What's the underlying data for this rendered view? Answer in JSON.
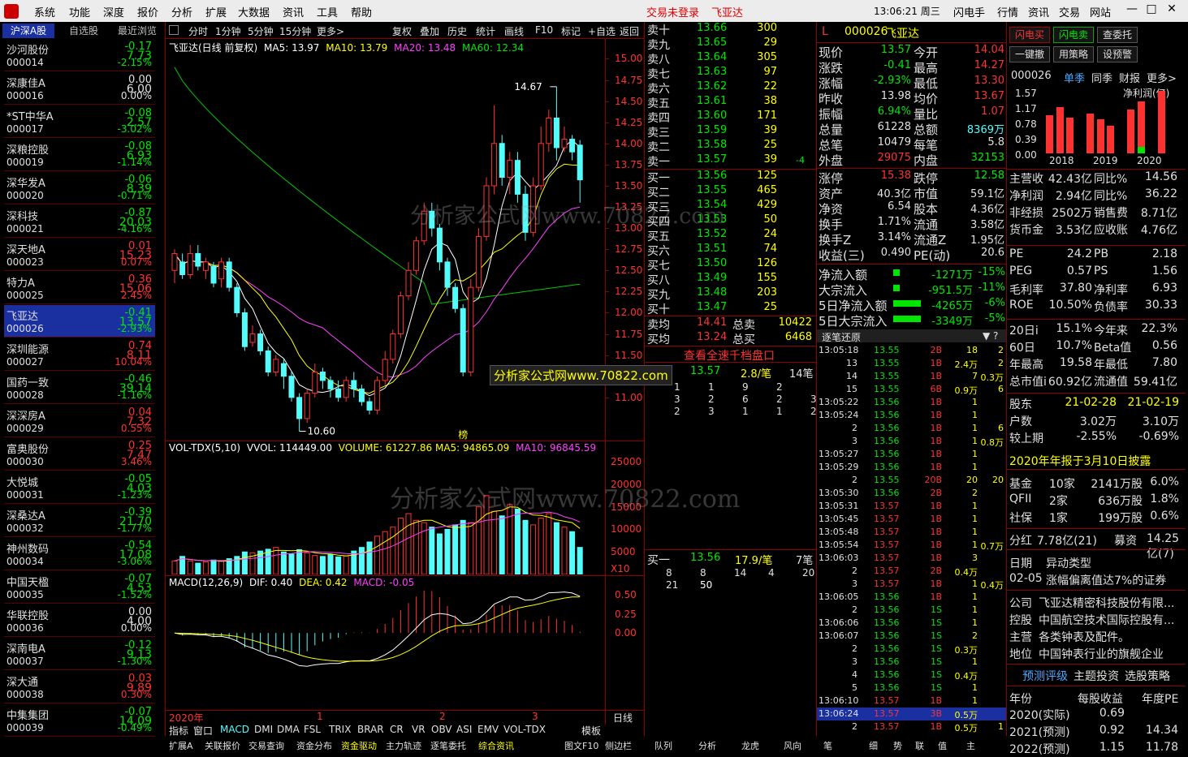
{
  "menu": {
    "items": [
      "系统",
      "功能",
      "深度",
      "报价",
      "分析",
      "扩展",
      "大数据",
      "资讯",
      "工具",
      "帮助"
    ],
    "trade_login": "交易未登录",
    "stock_name": "飞亚达",
    "clock": "13:06:21 周三",
    "right_items": [
      "闪电手",
      "行情",
      "资讯",
      "交易",
      "网站"
    ]
  },
  "list_tabs": [
    "沪深A股",
    "自选股",
    "最近浏览"
  ],
  "stocks": [
    {
      "name": "沙河股份",
      "code": "000014",
      "price": "7.73",
      "chg": "-0.17",
      "pct": "-2.15%",
      "up": false
    },
    {
      "name": "深康佳A",
      "code": "000016",
      "price": "6.00",
      "chg": "0.00",
      "pct": "0.00%",
      "up": null
    },
    {
      "name": "*ST中华A",
      "code": "000017",
      "price": "2.57",
      "chg": "-0.08",
      "pct": "-3.02%",
      "up": false
    },
    {
      "name": "深粮控股",
      "code": "000019",
      "price": "6.93",
      "chg": "-0.08",
      "pct": "-1.14%",
      "up": false
    },
    {
      "name": "深华发A",
      "code": "000020",
      "price": "8.39",
      "chg": "-0.06",
      "pct": "-0.71%",
      "up": false
    },
    {
      "name": "深科技",
      "code": "000021",
      "price": "20.03",
      "chg": "-0.87",
      "pct": "-4.16%",
      "up": false
    },
    {
      "name": "深天地A",
      "code": "000023",
      "price": "15.23",
      "chg": "0.01",
      "pct": "0.07%",
      "up": true
    },
    {
      "name": "特力A",
      "code": "000025",
      "price": "15.06",
      "chg": "0.36",
      "pct": "2.45%",
      "up": true
    },
    {
      "name": "飞亚达",
      "code": "000026",
      "price": "13.57",
      "chg": "-0.41",
      "pct": "-2.93%",
      "up": false,
      "selected": true
    },
    {
      "name": "深圳能源",
      "code": "000027",
      "price": "8.11",
      "chg": "0.74",
      "pct": "10.04%",
      "up": true
    },
    {
      "name": "国药一致",
      "code": "000028",
      "price": "39.14",
      "chg": "-0.46",
      "pct": "-1.16%",
      "up": false
    },
    {
      "name": "深深房A",
      "code": "000029",
      "price": "7.32",
      "chg": "0.04",
      "pct": "0.55%",
      "up": true
    },
    {
      "name": "富奥股份",
      "code": "000030",
      "price": "7.47",
      "chg": "0.25",
      "pct": "3.46%",
      "up": true
    },
    {
      "name": "大悦城",
      "code": "000031",
      "price": "4.03",
      "chg": "-0.05",
      "pct": "-1.23%",
      "up": false
    },
    {
      "name": "深桑达A",
      "code": "000032",
      "price": "21.70",
      "chg": "-0.39",
      "pct": "-1.77%",
      "up": false
    },
    {
      "name": "神州数码",
      "code": "000034",
      "price": "17.08",
      "chg": "-0.54",
      "pct": "-3.06%",
      "up": false
    },
    {
      "name": "中国天楹",
      "code": "000035",
      "price": "4.53",
      "chg": "-0.07",
      "pct": "-1.52%",
      "up": false
    },
    {
      "name": "华联控股",
      "code": "000036",
      "price": "4.00",
      "chg": "0.00",
      "pct": "0.00%",
      "up": null
    },
    {
      "name": "深南电A",
      "code": "000037",
      "price": "9.13",
      "chg": "-0.12",
      "pct": "-1.30%",
      "up": false
    },
    {
      "name": "深大通",
      "code": "000038",
      "price": "9.89",
      "chg": "0.03",
      "pct": "0.30%",
      "up": true
    },
    {
      "name": "中集集团",
      "code": "000039",
      "price": "14.09",
      "chg": "-0.07",
      "pct": "-0.49%",
      "up": false
    }
  ],
  "chart_toolbar": [
    "分时",
    "1分钟",
    "5分钟",
    "15分钟",
    "更多>",
    "复权",
    "叠加",
    "历史",
    "统计",
    "画线",
    "F10",
    "标记",
    "+自选",
    "返回"
  ],
  "kline_header": {
    "title": "飞亚达(日线 前复权)",
    "ma5": "MA5: 13.97",
    "ma10": "MA10: 13.79",
    "ma20": "MA20: 13.48",
    "ma60": "MA60: 12.34"
  },
  "kline_axis": [
    "15.00",
    "14.75",
    "14.50",
    "14.25",
    "14.00",
    "13.75",
    "13.50",
    "13.25",
    "13.00",
    "12.75",
    "12.50",
    "12.25",
    "12.00",
    "11.75",
    "11.50",
    "11.25",
    "11.00"
  ],
  "kline_marks": {
    "high": "14.67",
    "low": "10.60",
    "bang": "榜"
  },
  "kline_candles": [
    [
      12.5,
      12.7,
      12.35,
      12.75
    ],
    [
      12.6,
      12.45,
      12.4,
      12.7
    ],
    [
      12.45,
      12.7,
      12.4,
      12.8
    ],
    [
      12.7,
      12.55,
      12.5,
      12.8
    ],
    [
      12.5,
      12.6,
      12.4,
      12.65
    ],
    [
      12.55,
      12.35,
      12.3,
      12.6
    ],
    [
      12.4,
      12.6,
      12.3,
      12.65
    ],
    [
      12.6,
      12.3,
      12.25,
      12.65
    ],
    [
      12.3,
      12.0,
      11.95,
      12.35
    ],
    [
      12.0,
      11.6,
      11.55,
      12.05
    ],
    [
      11.65,
      11.75,
      11.6,
      11.85
    ],
    [
      11.75,
      11.55,
      11.5,
      11.8
    ],
    [
      11.55,
      11.3,
      11.25,
      11.6
    ],
    [
      11.3,
      11.45,
      11.25,
      11.5
    ],
    [
      11.4,
      11.25,
      11.1,
      11.45
    ],
    [
      11.25,
      11.0,
      10.95,
      11.3
    ],
    [
      11.0,
      10.75,
      10.6,
      11.05
    ],
    [
      10.75,
      11.05,
      10.7,
      11.1
    ],
    [
      11.05,
      11.3,
      11.0,
      11.4
    ],
    [
      11.3,
      11.2,
      11.1,
      11.35
    ],
    [
      11.2,
      11.1,
      11.0,
      11.25
    ],
    [
      11.1,
      11.0,
      10.95,
      11.2
    ],
    [
      11.0,
      11.2,
      10.95,
      11.25
    ],
    [
      11.2,
      11.1,
      11.0,
      11.3
    ],
    [
      11.1,
      10.95,
      10.9,
      11.15
    ],
    [
      10.95,
      10.85,
      10.8,
      11.0
    ],
    [
      10.85,
      11.2,
      10.8,
      11.25
    ],
    [
      11.2,
      11.45,
      11.15,
      11.55
    ],
    [
      11.45,
      11.75,
      11.4,
      11.8
    ],
    [
      11.75,
      12.2,
      11.7,
      12.25
    ],
    [
      12.2,
      12.5,
      12.15,
      12.6
    ],
    [
      12.5,
      12.85,
      12.45,
      12.9
    ],
    [
      12.85,
      13.2,
      12.8,
      13.3
    ],
    [
      13.2,
      13.0,
      12.9,
      13.3
    ],
    [
      13.0,
      12.6,
      12.5,
      13.05
    ],
    [
      12.6,
      12.3,
      12.2,
      12.65
    ],
    [
      12.3,
      12.05,
      12.0,
      12.35
    ],
    [
      12.05,
      11.3,
      11.25,
      12.1
    ],
    [
      11.3,
      12.3,
      11.25,
      12.4
    ],
    [
      12.3,
      12.9,
      12.25,
      13.0
    ],
    [
      12.9,
      13.5,
      12.85,
      13.6
    ],
    [
      13.5,
      14.0,
      13.4,
      14.45
    ],
    [
      14.0,
      13.6,
      13.5,
      14.1
    ],
    [
      13.6,
      13.8,
      13.4,
      13.9
    ],
    [
      13.8,
      13.4,
      13.3,
      13.9
    ],
    [
      13.4,
      12.95,
      12.85,
      13.5
    ],
    [
      12.95,
      13.5,
      12.9,
      13.6
    ],
    [
      13.5,
      14.0,
      13.45,
      14.2
    ],
    [
      14.0,
      14.3,
      13.9,
      14.4
    ],
    [
      14.3,
      13.95,
      13.8,
      14.67
    ],
    [
      13.95,
      14.05,
      13.9,
      14.2
    ],
    [
      14.05,
      13.9,
      13.8,
      14.1
    ],
    [
      13.98,
      13.57,
      13.3,
      14.04
    ]
  ],
  "vol_header": {
    "name": "VOL-TDX(5,10)",
    "vvol": "VVOL: 114449.00",
    "volume": "VOLUME: 61227.86",
    "ma5": "MA5: 94865.09",
    "ma10": "MA10: 96845.59"
  },
  "vol_axis": [
    "25000",
    "20000",
    "15000",
    "10000",
    "5000",
    "X10"
  ],
  "volumes": [
    3000,
    4000,
    3000,
    2500,
    2800,
    3200,
    3000,
    3500,
    4000,
    5000,
    4800,
    5200,
    5600,
    6000,
    5000,
    4500,
    5500,
    4800,
    4200,
    4000,
    4400,
    3900,
    4100,
    5200,
    6000,
    7200,
    8500,
    9500,
    10500,
    12500,
    13500,
    12000,
    11500,
    10500,
    9000,
    10000,
    11000,
    12000,
    11500,
    15000,
    17500,
    14000,
    13000,
    15500,
    14500,
    12000,
    11000,
    12500,
    13500,
    11500,
    10500,
    9500,
    6000
  ],
  "macd_header": {
    "name": "MACD(12,26,9)",
    "dif": "DIF: 0.40",
    "dea": "DEA: 0.42",
    "macd": "MACD: -0.05"
  },
  "macd_axis": [
    "0.50",
    "0.25",
    "0.00"
  ],
  "date_axis": {
    "year": "2020年",
    "m1": "1",
    "m2": "2",
    "m3": "3",
    "period": "日线"
  },
  "indicator_tabs": [
    "指标",
    "窗口",
    "MACD",
    "DMI",
    "DMA",
    "FSL",
    "TRIX",
    "BRAR",
    "CR",
    "VR",
    "OBV",
    "ASI",
    "EMV",
    "VOL-TDX",
    "模板"
  ],
  "bottom_tabs": [
    "扩展A",
    "关联报价",
    "交易查询",
    "资金分布",
    "资金驱动",
    "主力轨迹",
    "逐笔委托",
    "综合资讯",
    "图文F10",
    "侧边栏"
  ],
  "watermark1": "分析家公式网www.70822.com",
  "watermark2": "分析家公式网www.70822.com",
  "watermark3": "分析家公式网www.70822.com",
  "orderbook": {
    "sell": [
      [
        "卖十",
        "13.66",
        "300"
      ],
      [
        "卖九",
        "13.65",
        "29"
      ],
      [
        "卖八",
        "13.64",
        "305"
      ],
      [
        "卖七",
        "13.63",
        "97"
      ],
      [
        "卖六",
        "13.62",
        "22"
      ],
      [
        "卖五",
        "13.61",
        "38"
      ],
      [
        "卖四",
        "13.60",
        "171"
      ],
      [
        "卖三",
        "13.59",
        "39"
      ],
      [
        "卖二",
        "13.58",
        "25"
      ],
      [
        "卖一",
        "13.57",
        "39",
        "-4"
      ]
    ],
    "buy": [
      [
        "买一",
        "13.56",
        "125"
      ],
      [
        "买二",
        "13.55",
        "465"
      ],
      [
        "买三",
        "13.54",
        "429"
      ],
      [
        "买四",
        "13.53",
        "50"
      ],
      [
        "买五",
        "13.52",
        "24"
      ],
      [
        "买六",
        "13.51",
        "74"
      ],
      [
        "买七",
        "13.50",
        "126"
      ],
      [
        "买八",
        "13.49",
        "155"
      ],
      [
        "买九",
        "13.48",
        "203"
      ],
      [
        "买十",
        "13.47",
        "25"
      ]
    ],
    "sell_avg": [
      "卖均",
      "14.41",
      "总卖",
      "10422"
    ],
    "buy_avg": [
      "买均",
      "13.24",
      "总买",
      "6468"
    ],
    "link": "查看全速千档盘口",
    "sell_queue": {
      "price": "13.57",
      "avg": "2.8/笔",
      "count": "14笔",
      "rows": [
        [
          "1",
          "1",
          "9",
          "2"
        ],
        [
          "3",
          "2",
          "6",
          "2",
          "3"
        ],
        [
          "2",
          "3",
          "1",
          "1",
          "2"
        ]
      ]
    },
    "buy_queue": {
      "label": "买一",
      "price": "13.56",
      "avg": "17.9/笔",
      "count": "7笔",
      "rows": [
        [
          "8",
          "8",
          "14",
          "4",
          "20"
        ],
        [
          "21",
          "50"
        ]
      ]
    }
  },
  "quote": {
    "flag": "L",
    "code": "000026",
    "name": "飞亚达",
    "rows": [
      [
        "现价",
        "13.57",
        "今开",
        "14.04"
      ],
      [
        "涨跌",
        "-0.41",
        "最高",
        "14.27"
      ],
      [
        "涨幅",
        "-2.93%",
        "最低",
        "13.30"
      ],
      [
        "昨收",
        "13.98",
        "均价",
        "13.67"
      ],
      [
        "振幅",
        "6.94%",
        "量比",
        "1.07"
      ],
      [
        "总量",
        "61228",
        "总额",
        "8369万"
      ],
      [
        "总笔",
        "10479",
        "每笔",
        "5.8"
      ],
      [
        "外盘",
        "29075",
        "内盘",
        "32153"
      ]
    ],
    "rows2": [
      [
        "涨停",
        "15.38",
        "跌停",
        "12.58"
      ],
      [
        "资产",
        "40.3亿",
        "市值",
        "59.1亿"
      ],
      [
        "净资",
        "6.54",
        "股本",
        "4.36亿"
      ],
      [
        "换手",
        "1.71%",
        "流通",
        "3.58亿"
      ],
      [
        "换手Z",
        "3.14%",
        "流通Z",
        "1.95亿"
      ],
      [
        "收益(三)",
        "0.490",
        "PE(动)",
        "20.6"
      ]
    ],
    "flows": [
      [
        "净流入额",
        "-1271万",
        "-15%"
      ],
      [
        "大宗流入",
        "-951.5万",
        "-11%"
      ],
      [
        "5日净流入额",
        "-4265万",
        "-6%"
      ],
      [
        "5日大宗流入",
        "-3349万",
        "-5%"
      ]
    ],
    "tick_title": "逐笔还原"
  },
  "ticks": [
    [
      "13:05:18",
      "13.55",
      "2B",
      "18",
      "2"
    ],
    [
      "13",
      "13.55",
      "1B",
      "2.4万",
      "2"
    ],
    [
      "14",
      "13.55",
      "1B",
      "7",
      "0.3万"
    ],
    [
      "15",
      "13.55",
      "6B",
      "0.9万",
      "6"
    ],
    [
      "13:05:22",
      "13.56",
      "1B",
      "1",
      ""
    ],
    [
      "13:05:24",
      "13.56",
      "1B",
      "1",
      ""
    ],
    [
      "2",
      "13.56",
      "1B",
      "1",
      "6"
    ],
    [
      "3",
      "13.56",
      "1B",
      "1",
      "0.8万"
    ],
    [
      "13:05:27",
      "13.56",
      "1B",
      "1",
      ""
    ],
    [
      "13:05:29",
      "13.56",
      "1B",
      "1",
      ""
    ],
    [
      "2",
      "13.55",
      "20B",
      "20",
      "20"
    ],
    [
      "13:05:30",
      "13.56",
      "2B",
      "2",
      ""
    ],
    [
      "13:05:31",
      "13.57",
      "1B",
      "1",
      ""
    ],
    [
      "13:05:45",
      "13.57",
      "1B",
      "1",
      ""
    ],
    [
      "13:05:48",
      "13.57",
      "1B",
      "1",
      ""
    ],
    [
      "13:05:54",
      "13.57",
      "1B",
      "1",
      "0.7万"
    ],
    [
      "13:06:03",
      "13.57",
      "1B",
      "3",
      ""
    ],
    [
      "2",
      "13.57",
      "2B",
      "0.4万",
      ""
    ],
    [
      "3",
      "13.57",
      "1B",
      "1",
      "0.4万"
    ],
    [
      "13:06:05",
      "13.56",
      "1B",
      "1",
      ""
    ],
    [
      "2",
      "13.56",
      "1S",
      "1",
      ""
    ],
    [
      "13:06:06",
      "13.56",
      "1S",
      "1",
      ""
    ],
    [
      "13:06:07",
      "13.56",
      "1S",
      "2",
      ""
    ],
    [
      "2",
      "13.56",
      "1S",
      "0.3万",
      ""
    ],
    [
      "3",
      "13.56",
      "1S",
      "1",
      ""
    ],
    [
      "4",
      "13.56",
      "1S",
      "0.4万",
      ""
    ],
    [
      "5",
      "13.56",
      "1S",
      "1",
      ""
    ],
    [
      "13:06:10",
      "13.57",
      "1B",
      "1",
      ""
    ],
    [
      "13:06:24",
      "13.57",
      "3B",
      "0.5万",
      ""
    ],
    [
      "2",
      "13.57",
      "1B",
      "0.5万",
      "1"
    ]
  ],
  "right": {
    "buttons": [
      "闪电买",
      "闪电卖",
      "查委托",
      "一键撤",
      "用策略",
      "设预警"
    ],
    "fin_tabs": [
      "000026",
      "单季",
      "同季",
      "财报",
      "更多>"
    ],
    "fin_title": "净利润(亿)",
    "fin_axis": [
      "1.57",
      "1.17",
      "0.78",
      "0.39",
      "0.00"
    ],
    "fin_years": [
      "2018",
      "2019",
      "2020"
    ],
    "fin_bars": [
      0.95,
      1.17,
      0.9,
      0.0,
      1.0,
      0.85,
      0.7,
      0.0,
      1.1,
      1.3,
      0.0,
      1.57
    ],
    "fin_rows": [
      [
        "主营收",
        "42.43亿",
        "同比%",
        "14.56"
      ],
      [
        "净利润",
        "2.94亿",
        "同比%",
        "36.22"
      ],
      [
        "非经损",
        "2502万",
        "销售费",
        "8.71亿"
      ],
      [
        "货币金",
        "3.53亿",
        "应收账",
        "4.76亿"
      ]
    ],
    "val_rows": [
      [
        "PE",
        "24.2",
        "PB",
        "2.18"
      ],
      [
        "PEG",
        "0.57",
        "PS",
        "1.56"
      ],
      [
        "毛利率",
        "37.80",
        "净利率",
        "6.93"
      ],
      [
        "ROE",
        "10.50%",
        "负债率",
        "30.33"
      ]
    ],
    "perf_rows": [
      [
        "20日i",
        "15.1%",
        "今年来",
        "22.3%"
      ],
      [
        "60日",
        "10.7%",
        "Beta值",
        "0.56"
      ],
      [
        "年最高",
        "19.58",
        "年最低",
        "7.80"
      ],
      [
        "总市值i",
        "60.92亿",
        "流通值",
        "59.41亿"
      ]
    ],
    "holder_rows": [
      [
        "股东",
        "21-02-28",
        "21-02-19"
      ],
      [
        "户数",
        "3.02万",
        "3.10万"
      ],
      [
        "较上期",
        "-2.55%",
        "-0.69%"
      ]
    ],
    "report_note": "2020年年报于3月10日披露",
    "inst_rows": [
      [
        "基金",
        "10家",
        "2141万股",
        "6.0%"
      ],
      [
        "QFII",
        "2家",
        "636万股",
        "1.8%"
      ],
      [
        "社保",
        "1家",
        "199万股",
        "0.6%"
      ]
    ],
    "div": [
      "分红",
      "7.78亿(21)",
      "募资",
      "14.25亿(7)"
    ],
    "event_head": [
      "日期",
      "异动类型"
    ],
    "event": [
      "02-05",
      "涨幅偏离值达7%的证券"
    ],
    "company": [
      [
        "公司",
        "飞亚达精密科技股份有限..."
      ],
      [
        "控股",
        "中国航空技术国际控股有..."
      ],
      [
        "主营",
        "各类钟表及配件。"
      ],
      [
        "地位",
        "中国钟表行业的旗舰企业"
      ]
    ],
    "links": [
      "预测评级",
      "主题投资",
      "选股策略"
    ],
    "eps_head": [
      "年份",
      "每股收益",
      "年度PE"
    ],
    "eps": [
      [
        "2020(实际)",
        "0.69",
        ""
      ],
      [
        "2021(预测)",
        "0.92",
        "14.34"
      ],
      [
        "2022(预测)",
        "1.15",
        "11.78"
      ]
    ]
  },
  "bottom_mid_tabs": [
    "队列",
    "分析",
    "龙虎",
    "风向"
  ],
  "bottom_right_tabs": [
    "笔",
    "细",
    "势",
    "联",
    "值",
    "主"
  ]
}
